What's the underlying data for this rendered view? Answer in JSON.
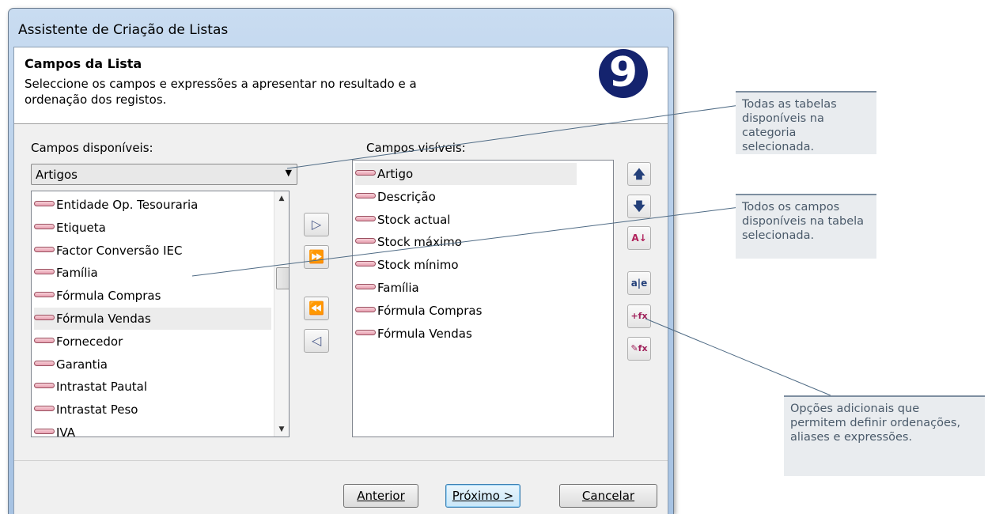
{
  "window": {
    "title": "Assistente de Criação de Listas"
  },
  "header": {
    "title": "Campos da Lista",
    "description": "Seleccione os campos e expressões a apresentar no resultado e a ordenação dos registos.",
    "logo_text": "9"
  },
  "available": {
    "label": "Campos disponíveis:",
    "table_select": "Artigos",
    "items": [
      "Entidade Op. Tesouraria",
      "Etiqueta",
      "Factor Conversão IEC",
      "Família",
      "Fórmula Compras",
      "Fórmula Vendas",
      "Fornecedor",
      "Garantia",
      "Intrastat Pautal",
      "Intrastat Peso",
      "IVA"
    ],
    "selected_index": 5
  },
  "visible": {
    "label": "Campos visíveis:",
    "items": [
      "Artigo",
      "Descrição",
      "Stock actual",
      "Stock máximo",
      "Stock mínimo",
      "Família",
      "Fórmula Compras",
      "Fórmula Vendas"
    ],
    "selected_index": 0
  },
  "transfer_buttons": {
    "add_glyph": "▷",
    "add_all_glyph": "⏩",
    "remove_all_glyph": "⏪",
    "remove_glyph": "◁"
  },
  "side_buttons": {
    "move_up_glyph": "🡅",
    "move_down_glyph": "🡇",
    "sort_glyph": "A↓",
    "alias_glyph": "a|e",
    "add_expr_glyph": "+fx",
    "edit_expr_glyph": "✎fx"
  },
  "footer": {
    "back": "Anterior",
    "next": "Próximo >",
    "cancel": "Cancelar"
  },
  "callouts": {
    "tables": "Todas as tabelas disponíveis na categoria selecionada.",
    "fields": "Todos os campos disponíveis na tabela selecionada.",
    "options": "Opções adicionais que permitem definir ordenações, aliases e expressões."
  },
  "colors": {
    "callout_bg": "#e9ecef",
    "callout_text": "#4a5a6a",
    "logo": "#14236e"
  }
}
